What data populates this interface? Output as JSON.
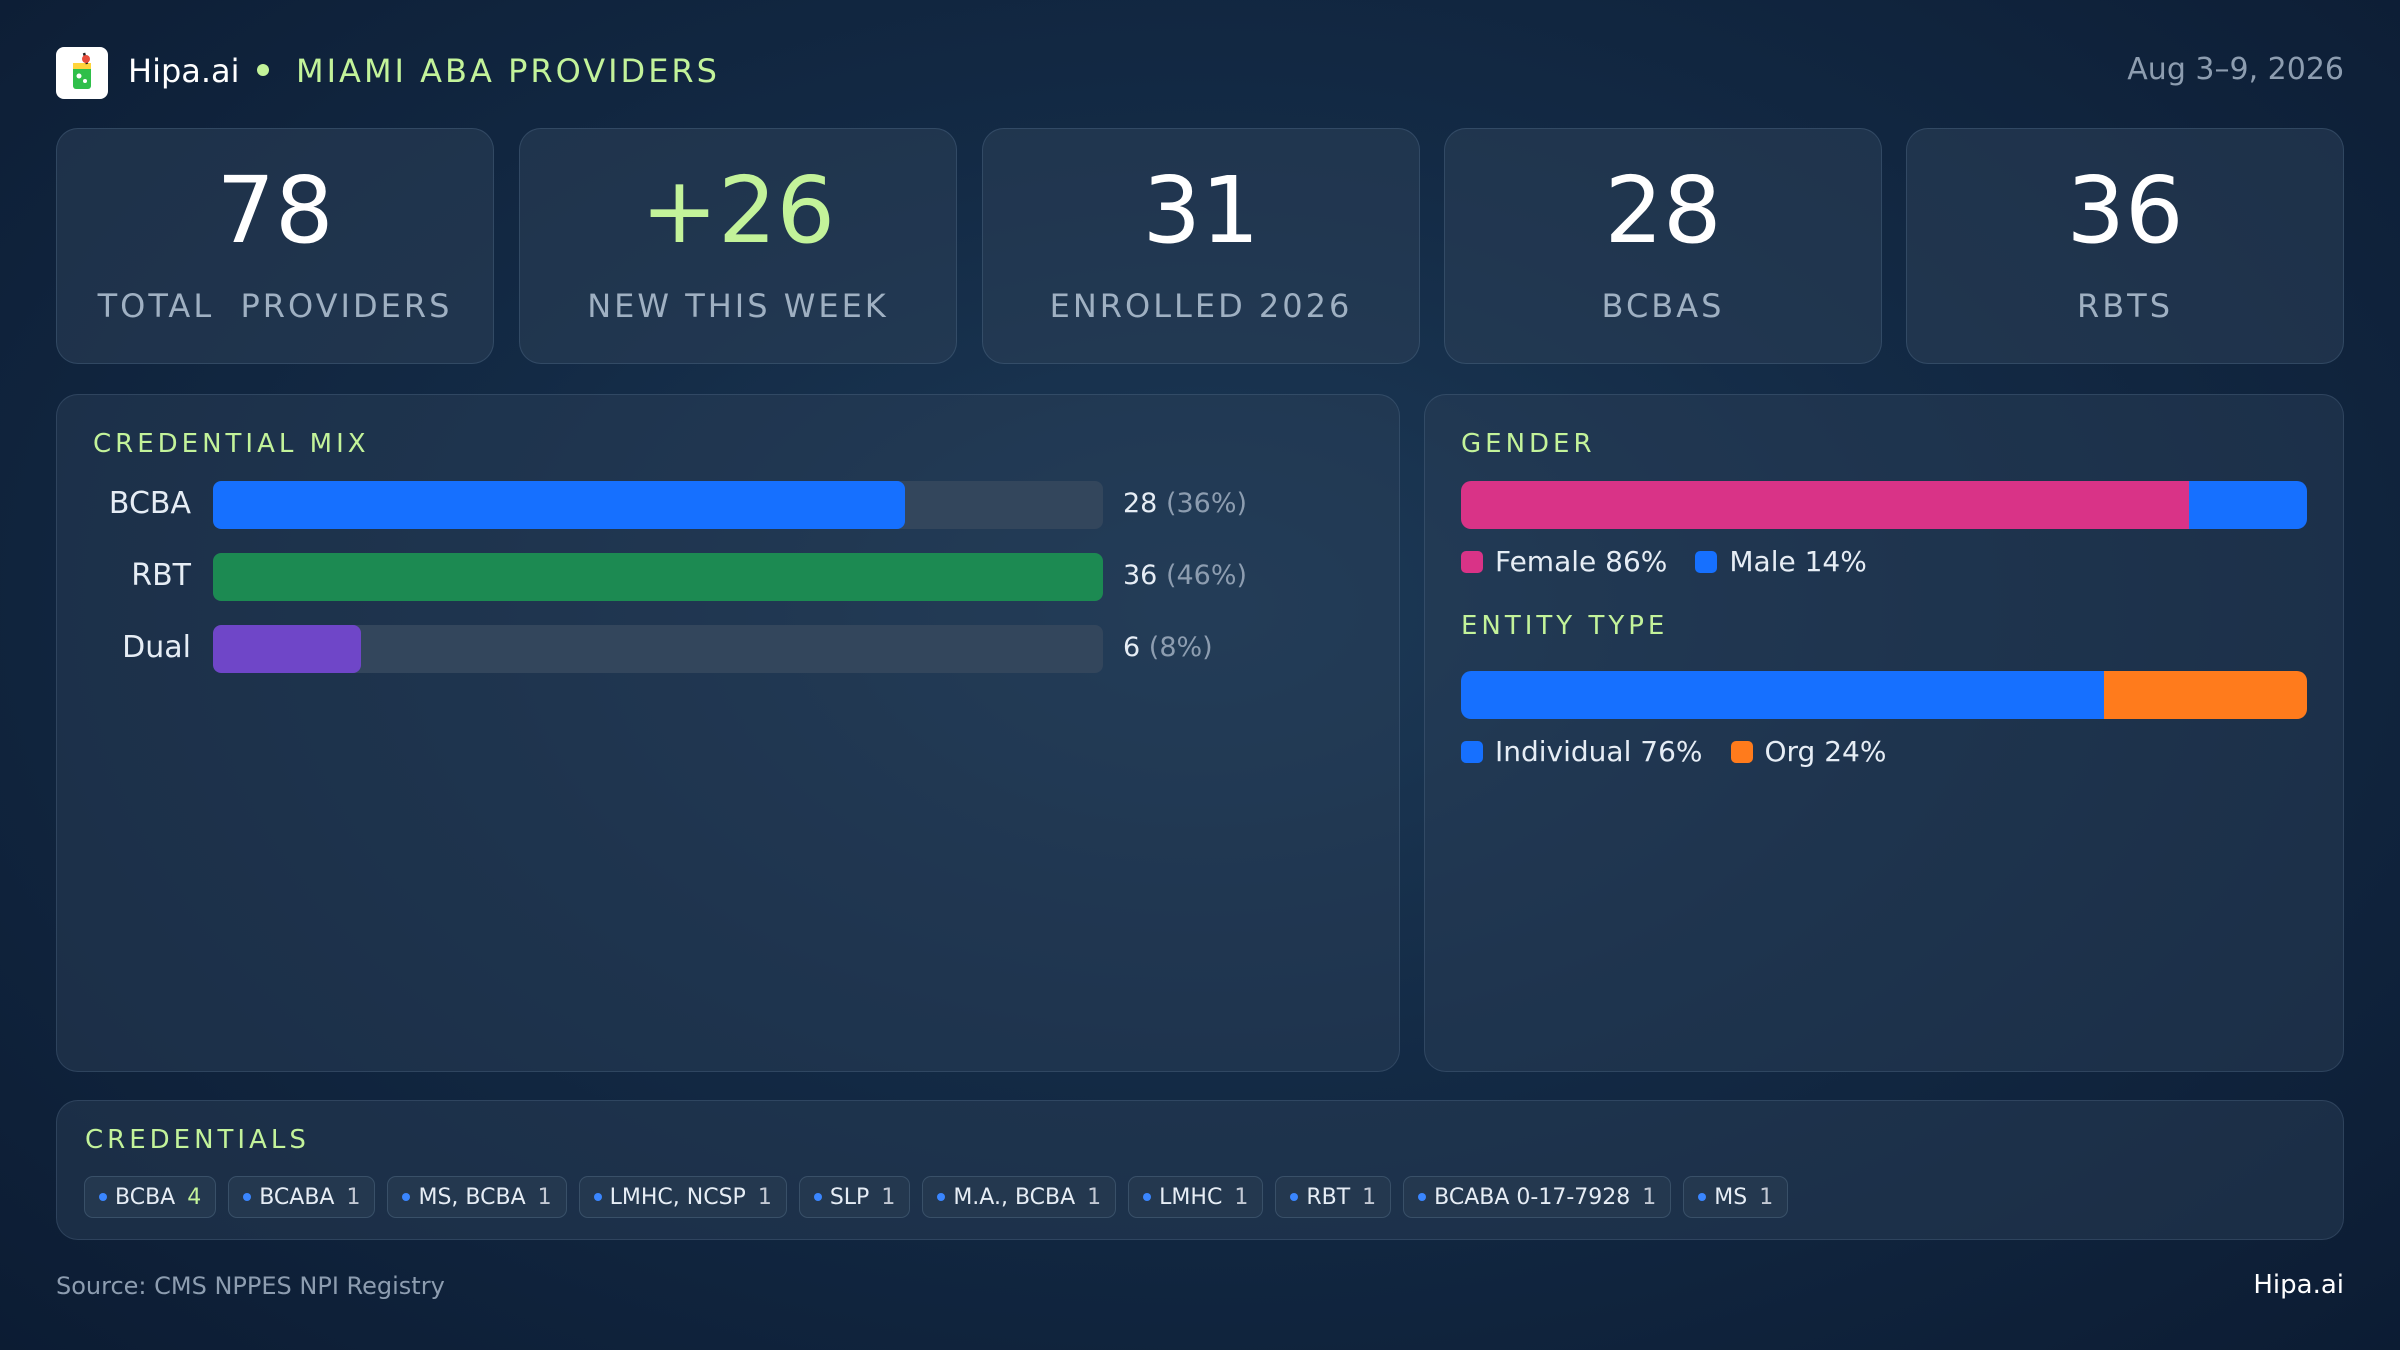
{
  "header": {
    "brand": "Hipa.ai",
    "title": "MIAMI ABA PROVIDERS",
    "date_range": "Aug 3–9, 2026",
    "accent_color": "#c3f39a"
  },
  "kpis": [
    {
      "value": "78",
      "label": "TOTAL  PROVIDERS",
      "color": "#ffffff"
    },
    {
      "value": "+26",
      "label": "NEW THIS WEEK",
      "color": "#c3f39a"
    },
    {
      "value": "31",
      "label": "ENROLLED 2026",
      "color": "#ffffff"
    },
    {
      "value": "28",
      "label": "BCBAS",
      "color": "#ffffff"
    },
    {
      "value": "36",
      "label": "RBTS",
      "color": "#ffffff"
    }
  ],
  "chart_data": [
    {
      "type": "bar",
      "title": "CREDENTIAL MIX",
      "orientation": "horizontal",
      "categories": [
        "BCBA",
        "RBT",
        "Dual"
      ],
      "values": [
        28,
        36,
        6
      ],
      "value_labels": [
        "28",
        "36",
        "6"
      ],
      "percent_labels": [
        "(36%)",
        "(46%)",
        "(8%)"
      ],
      "colors": [
        "#1670ff",
        "#1c8a52",
        "#6f46c8"
      ],
      "xlim": [
        0,
        36
      ]
    },
    {
      "type": "bar",
      "title": "GENDER",
      "stacked": true,
      "series": [
        {
          "name": "Female 86%",
          "value": 86,
          "color": "#d93387"
        },
        {
          "name": "Male 14%",
          "value": 14,
          "color": "#1670ff"
        }
      ]
    },
    {
      "type": "bar",
      "title": "ENTITY TYPE",
      "stacked": true,
      "series": [
        {
          "name": "Individual 76%",
          "value": 76,
          "color": "#1670ff"
        },
        {
          "name": "Org 24%",
          "value": 24,
          "color": "#ff7b1c"
        }
      ]
    }
  ],
  "credentials": {
    "title": "CREDENTIALS",
    "chips": [
      {
        "label": "BCBA",
        "count": "4"
      },
      {
        "label": "BCABA",
        "count": "1"
      },
      {
        "label": "MS, BCBA",
        "count": "1"
      },
      {
        "label": "LMHC, NCSP",
        "count": "1"
      },
      {
        "label": "SLP",
        "count": "1"
      },
      {
        "label": "M.A., BCBA",
        "count": "1"
      },
      {
        "label": "LMHC",
        "count": "1"
      },
      {
        "label": "RBT",
        "count": "1"
      },
      {
        "label": "BCABA 0-17-7928",
        "count": "1"
      },
      {
        "label": "MS",
        "count": "1"
      }
    ]
  },
  "footer": {
    "source": "Source: CMS NPPES NPI Registry",
    "brand": "Hipa.ai"
  }
}
